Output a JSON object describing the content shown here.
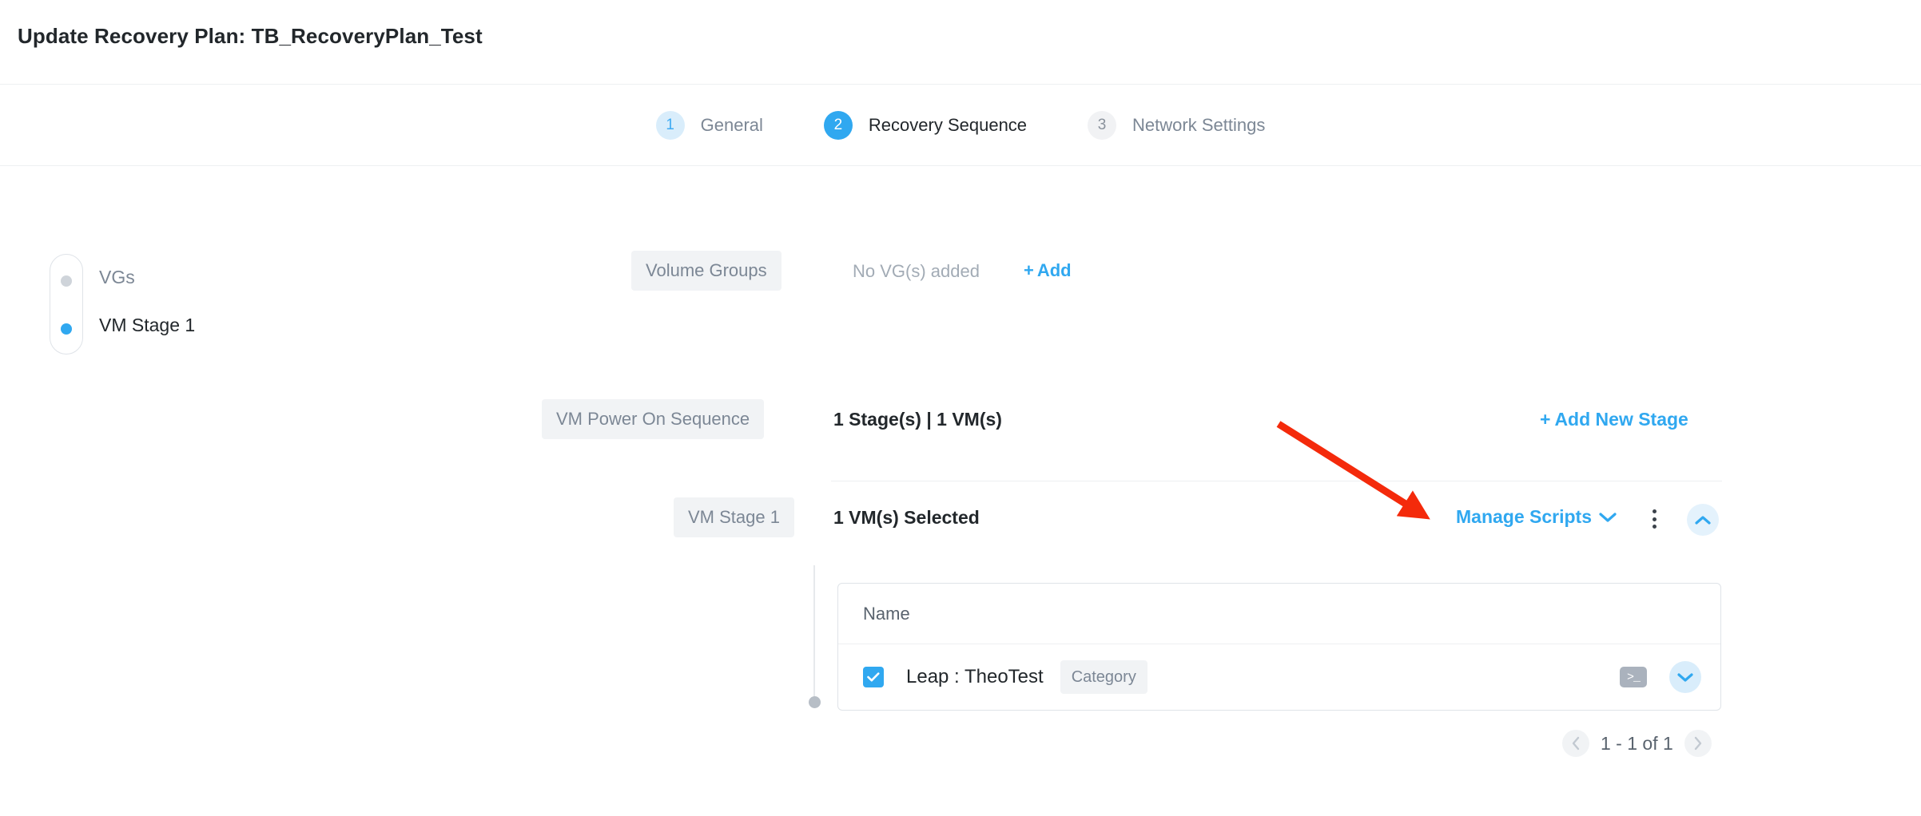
{
  "header": {
    "title": "Update Recovery Plan: TB_RecoveryPlan_Test"
  },
  "wizard": {
    "steps": [
      {
        "number": "1",
        "label": "General",
        "state": "completed"
      },
      {
        "number": "2",
        "label": "Recovery Sequence",
        "state": "active"
      },
      {
        "number": "3",
        "label": "Network Settings",
        "state": "upcoming"
      }
    ]
  },
  "stage_nav": {
    "items": [
      {
        "label": "VGs",
        "active": false
      },
      {
        "label": "VM Stage 1",
        "active": true
      }
    ]
  },
  "volume_groups": {
    "chip_label": "Volume Groups",
    "empty_text": "No VG(s) added",
    "add_plus": "+",
    "add_label": "Add"
  },
  "power_on_sequence": {
    "chip_label": "VM Power On Sequence",
    "summary": "1 Stage(s) | 1 VM(s)",
    "add_plus": "+",
    "add_stage_label": "Add New Stage"
  },
  "stage": {
    "chip_label": "VM Stage 1",
    "selected_summary": "1 VM(s) Selected",
    "manage_scripts_label": "Manage Scripts",
    "kebab_icon": "more-vertical-icon",
    "collapse_icon": "chevron-up-icon"
  },
  "vm_table": {
    "columns": [
      "Name"
    ],
    "rows": [
      {
        "checked": true,
        "name": "Leap : TheoTest",
        "badge": "Category",
        "script_icon": "terminal-icon",
        "expand_icon": "chevron-down-icon"
      }
    ]
  },
  "pagination": {
    "prev_icon": "chevron-left-icon",
    "next_icon": "chevron-right-icon",
    "range_label": "1 - 1 of 1"
  },
  "annotation": {
    "arrow_color": "#f42a0b",
    "points_to": "Manage Scripts"
  },
  "colors": {
    "accent_blue": "#30a8f0",
    "accent_blue_pale": "#d9edfb",
    "text_dark": "#22272b",
    "text_muted": "#7c8795",
    "chip_bg": "#f1f3f5",
    "border": "#dfe3e8",
    "divider": "#eef0f2",
    "annotation_red": "#f42a0b"
  }
}
